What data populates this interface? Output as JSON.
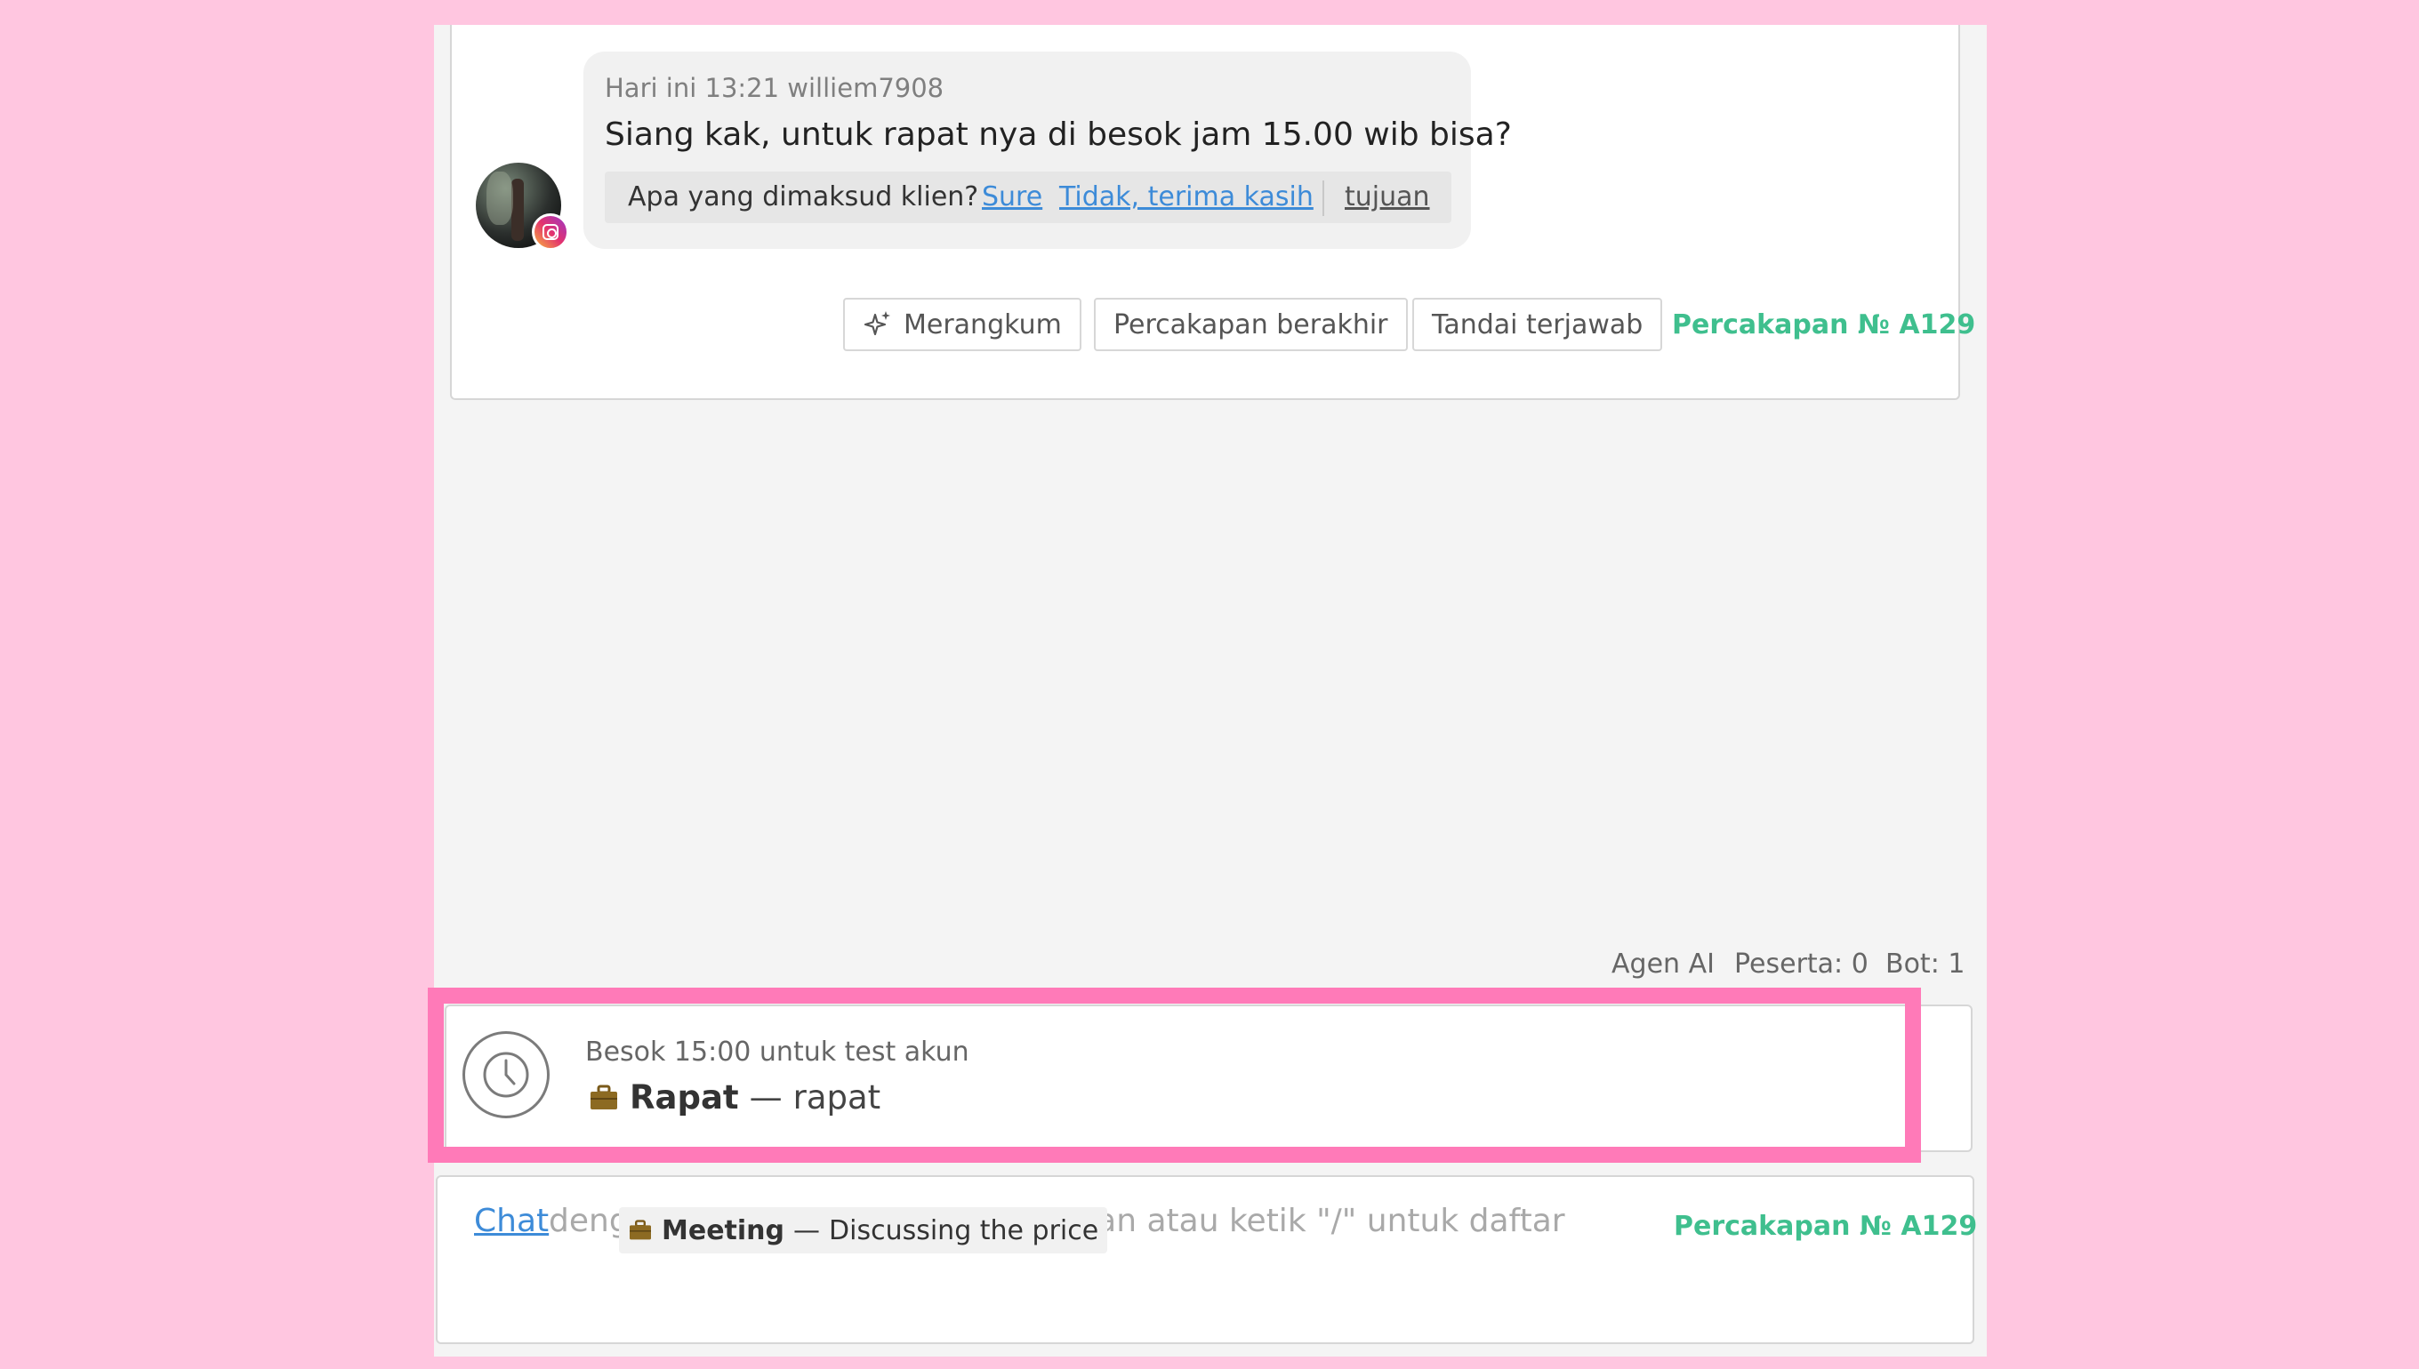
{
  "message": {
    "meta": "Hari ini 13:21 williem7908",
    "text": "Siang kak, untuk rapat nya di besok jam 15.00 wib bisa?",
    "intent_question": "Apa yang dimaksud klien?",
    "intent_options": [
      "Sure",
      "Tidak, terima kasih"
    ],
    "intent_extra": "tujuan",
    "channel_icon": "instagram-icon"
  },
  "actions": {
    "summarize_label": "Merangkum",
    "end_label": "Percakapan berakhir",
    "mark_answered_label": "Tandai terjawab",
    "conversation_id": "Percakapan № A129"
  },
  "stats": {
    "ai_agent": "Agen AI",
    "participants": "Peserta: 0",
    "bots": "Bot: 1"
  },
  "task": {
    "time": "Besok 15:00 untuk test akun",
    "type_icon": "briefcase-icon",
    "title": "Rapat",
    "separator": "—",
    "desc": "rapat",
    "highlight_color": "#ff7ab8"
  },
  "composer": {
    "chat_link": "Chat",
    "placeholder": "dengan pelanggan. Masukkan pesan atau ketik \"/\" untuk daftar Sal...",
    "conversation_id": "Percakapan № A129",
    "tooltip_title": "Meeting",
    "tooltip_separator": "—",
    "tooltip_desc": "Discussing the price"
  },
  "colors": {
    "background": "#ffc6e0",
    "accent_green": "#3fbf8e",
    "link_blue": "#3d8bd8"
  }
}
